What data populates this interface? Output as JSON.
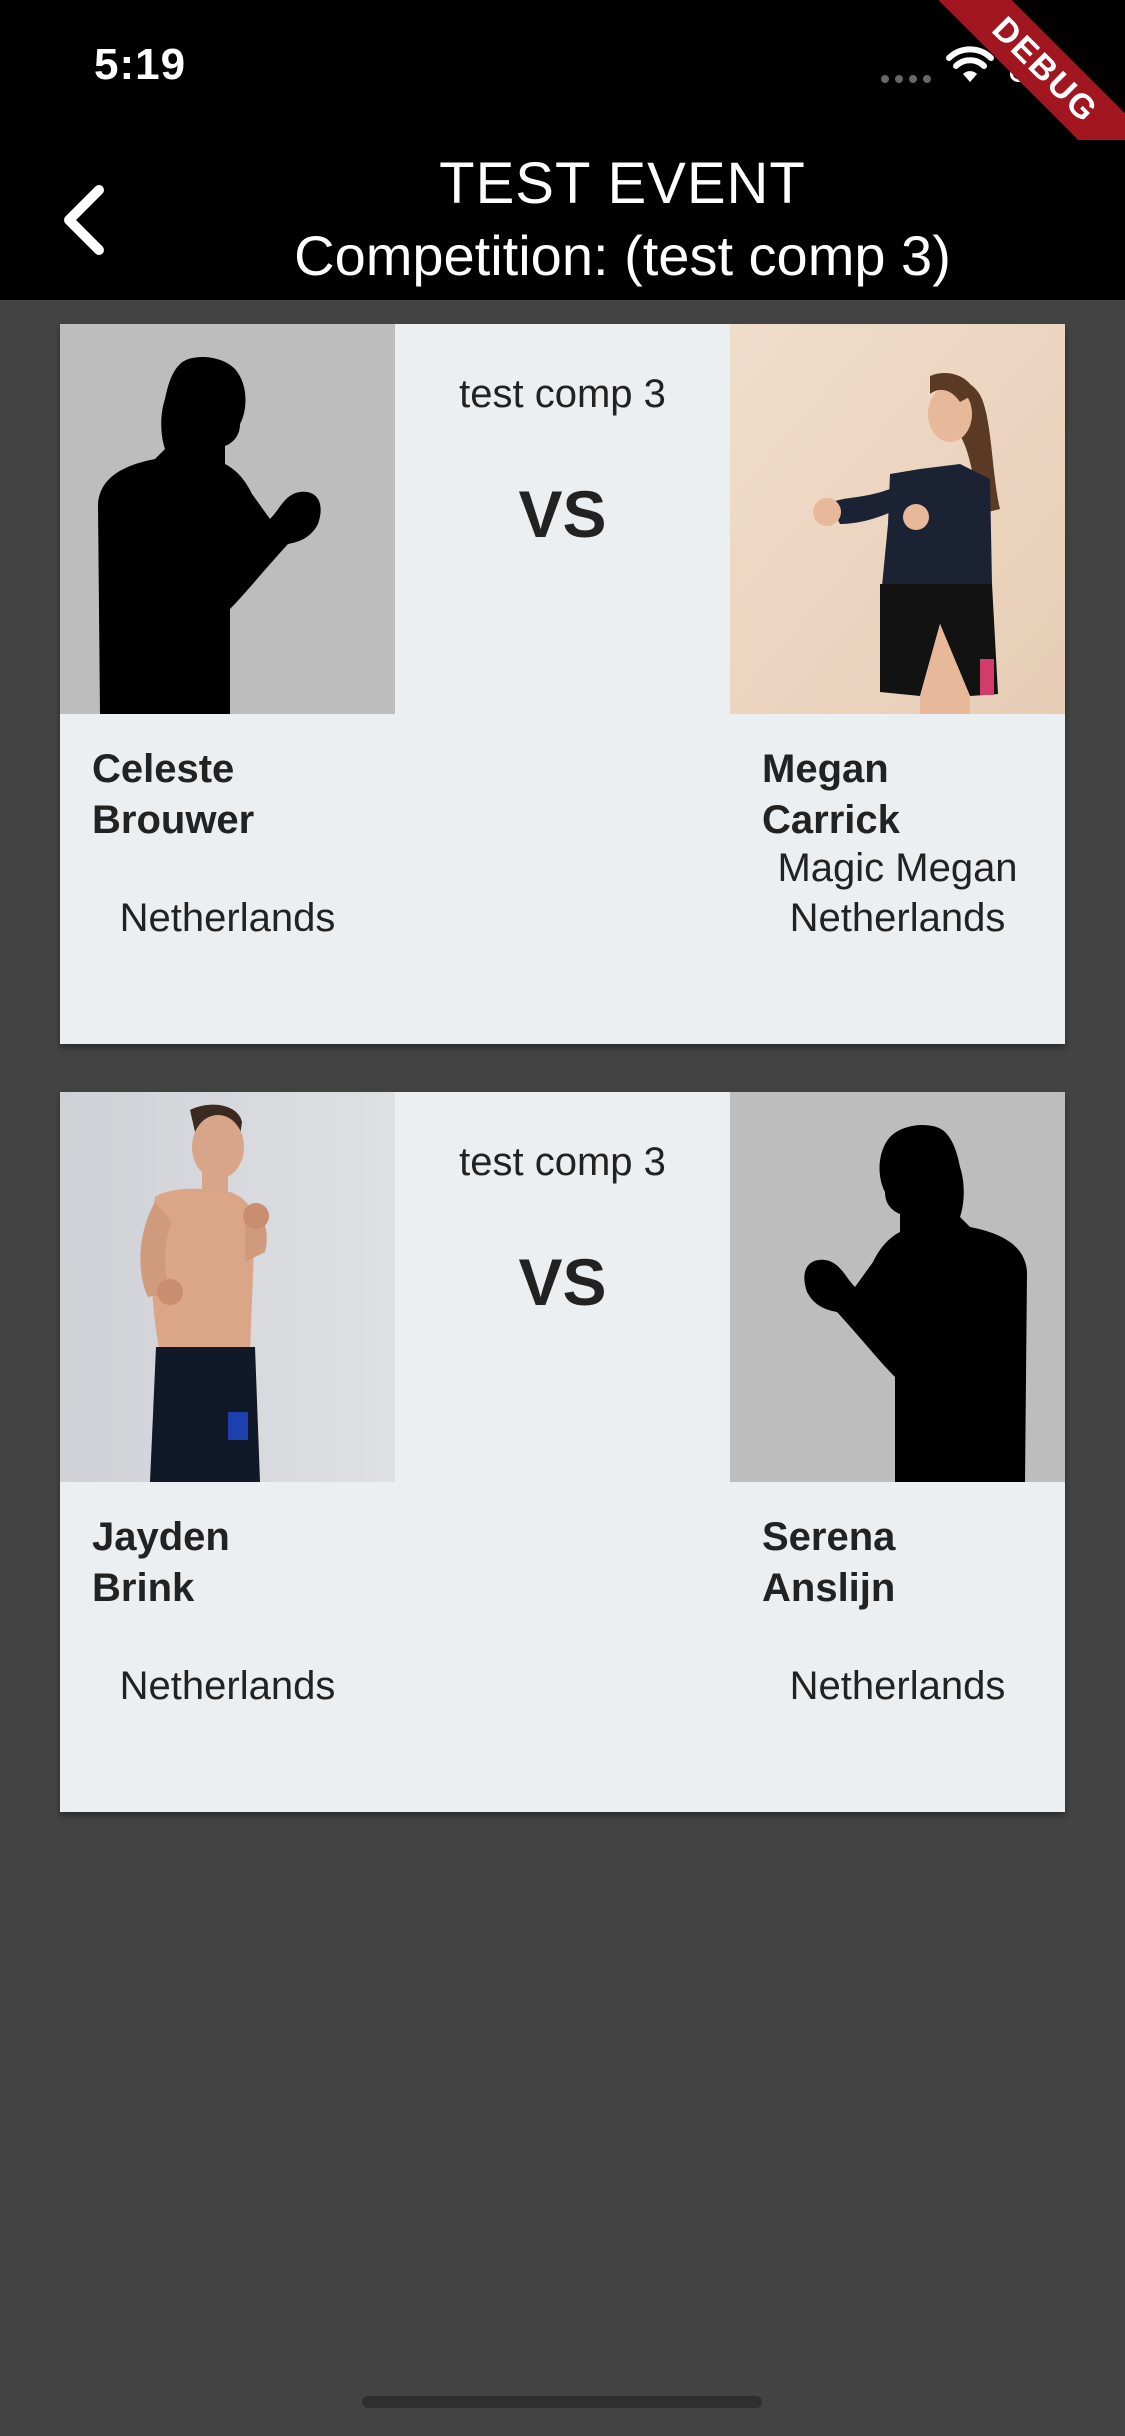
{
  "status_bar": {
    "time": "5:19",
    "debug_label": "DEBUG"
  },
  "app_bar": {
    "title_line1": "TEST EVENT",
    "title_line2": "Competition: (test comp 3)"
  },
  "bouts": [
    {
      "competition": "test comp 3",
      "vs_label": "VS",
      "left": {
        "name_first": "Celeste",
        "name_last": "Brouwer",
        "nickname": "",
        "country": "Netherlands",
        "photo": "silhouette"
      },
      "right": {
        "name_first": "Megan",
        "name_last": "Carrick",
        "nickname": "Magic Megan",
        "country": "Netherlands",
        "photo": "fighter-photo"
      }
    },
    {
      "competition": "test comp 3",
      "vs_label": "VS",
      "left": {
        "name_first": "Jayden",
        "name_last": "Brink",
        "nickname": "",
        "country": "Netherlands",
        "photo": "fighter-photo"
      },
      "right": {
        "name_first": "Serena",
        "name_last": "Anslijn",
        "nickname": "",
        "country": "Netherlands",
        "photo": "silhouette"
      }
    }
  ]
}
